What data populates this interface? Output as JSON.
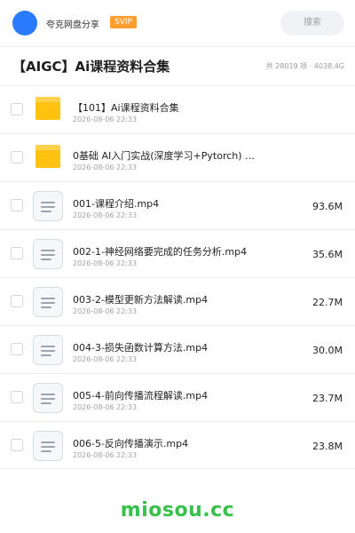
{
  "header": {
    "share_title": "夸克网盘分享",
    "badge": "SVIP",
    "search_placeholder": "搜索"
  },
  "folder": {
    "title": "【AIGC】Ai课程资料合集",
    "meta": "共 28019 项 · 4038.4G"
  },
  "items": [
    {
      "type": "folder",
      "name": "【101】Ai课程资料合集",
      "date": "2026-08-06 22:33",
      "size": ""
    },
    {
      "type": "folder",
      "name": "0基础 AI入门实战(深度学习+Pytorch) …",
      "date": "2026-08-06 22:33",
      "size": ""
    },
    {
      "type": "file",
      "name": "001-课程介绍.mp4",
      "date": "2026-08-06 22:33",
      "size": "93.6M"
    },
    {
      "type": "file",
      "name": "002-1-神经网络要完成的任务分析.mp4",
      "date": "2026-08-06 22:33",
      "size": "35.6M"
    },
    {
      "type": "file",
      "name": "003-2-模型更新方法解读.mp4",
      "date": "2026-08-06 22:33",
      "size": "22.7M"
    },
    {
      "type": "file",
      "name": "004-3-损失函数计算方法.mp4",
      "date": "2026-08-06 22:33",
      "size": "30.0M"
    },
    {
      "type": "file",
      "name": "005-4-前向传播流程解读.mp4",
      "date": "2026-08-06 22:33",
      "size": "23.7M"
    },
    {
      "type": "file",
      "name": "006-5-反向传播演示.mp4",
      "date": "2026-08-06 22:33",
      "size": "23.8M"
    }
  ],
  "footer": {
    "watermark": "miosou.cc"
  },
  "colors": {
    "accent_blue": "#2b7bff",
    "svip_orange": "#ff9e2c",
    "folder_yellow": "#ffc210",
    "watermark_green": "#36c24a"
  }
}
